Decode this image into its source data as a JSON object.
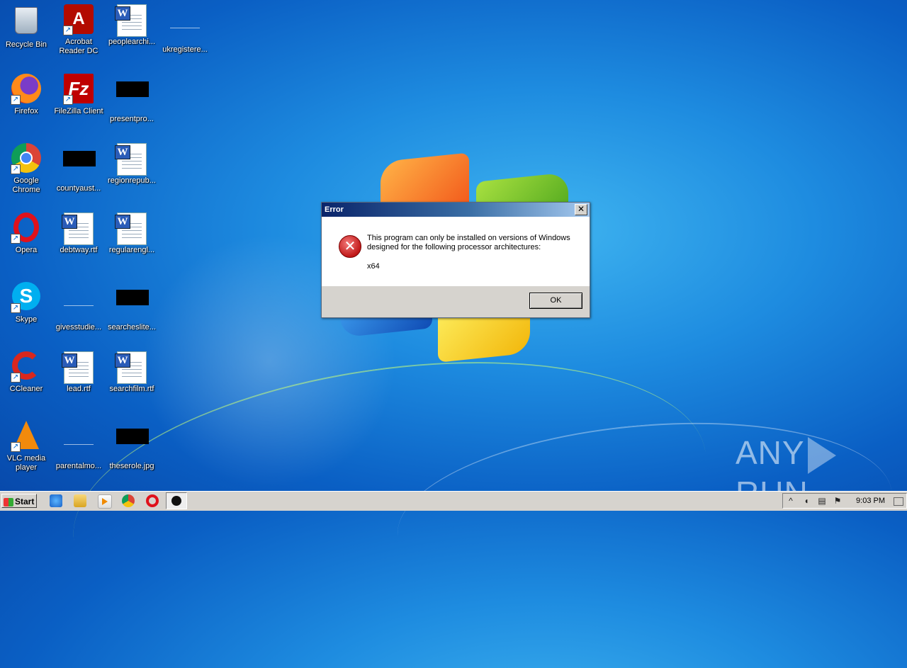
{
  "desktop": {
    "icons": [
      {
        "label": "Recycle Bin"
      },
      {
        "label": "Acrobat Reader DC"
      },
      {
        "label": "peoplearchi..."
      },
      {
        "label": "ukregistere..."
      },
      {
        "label": "Firefox"
      },
      {
        "label": "FileZilla Client"
      },
      {
        "label": "presentpro..."
      },
      {
        "label": "Google Chrome"
      },
      {
        "label": "countyaust..."
      },
      {
        "label": "regionrepub..."
      },
      {
        "label": "Opera"
      },
      {
        "label": "debtway.rtf"
      },
      {
        "label": "regularengl..."
      },
      {
        "label": "Skype"
      },
      {
        "label": "givesstudie..."
      },
      {
        "label": "searcheslite..."
      },
      {
        "label": "CCleaner"
      },
      {
        "label": "lead.rtf"
      },
      {
        "label": "searchfilm.rtf"
      },
      {
        "label": "VLC media player"
      },
      {
        "label": "parentalmo..."
      },
      {
        "label": "theserole.jpg"
      }
    ]
  },
  "dialog": {
    "title": "Error",
    "message_line1": "This program can only be installed on versions of Windows",
    "message_line2": "designed for the following processor architectures:",
    "architecture": "x64",
    "ok_label": "OK",
    "close_glyph": "✕"
  },
  "watermark": {
    "left": "ANY",
    "right": "RUN"
  },
  "taskbar": {
    "start_label": "Start",
    "clock": "9:03 PM"
  }
}
